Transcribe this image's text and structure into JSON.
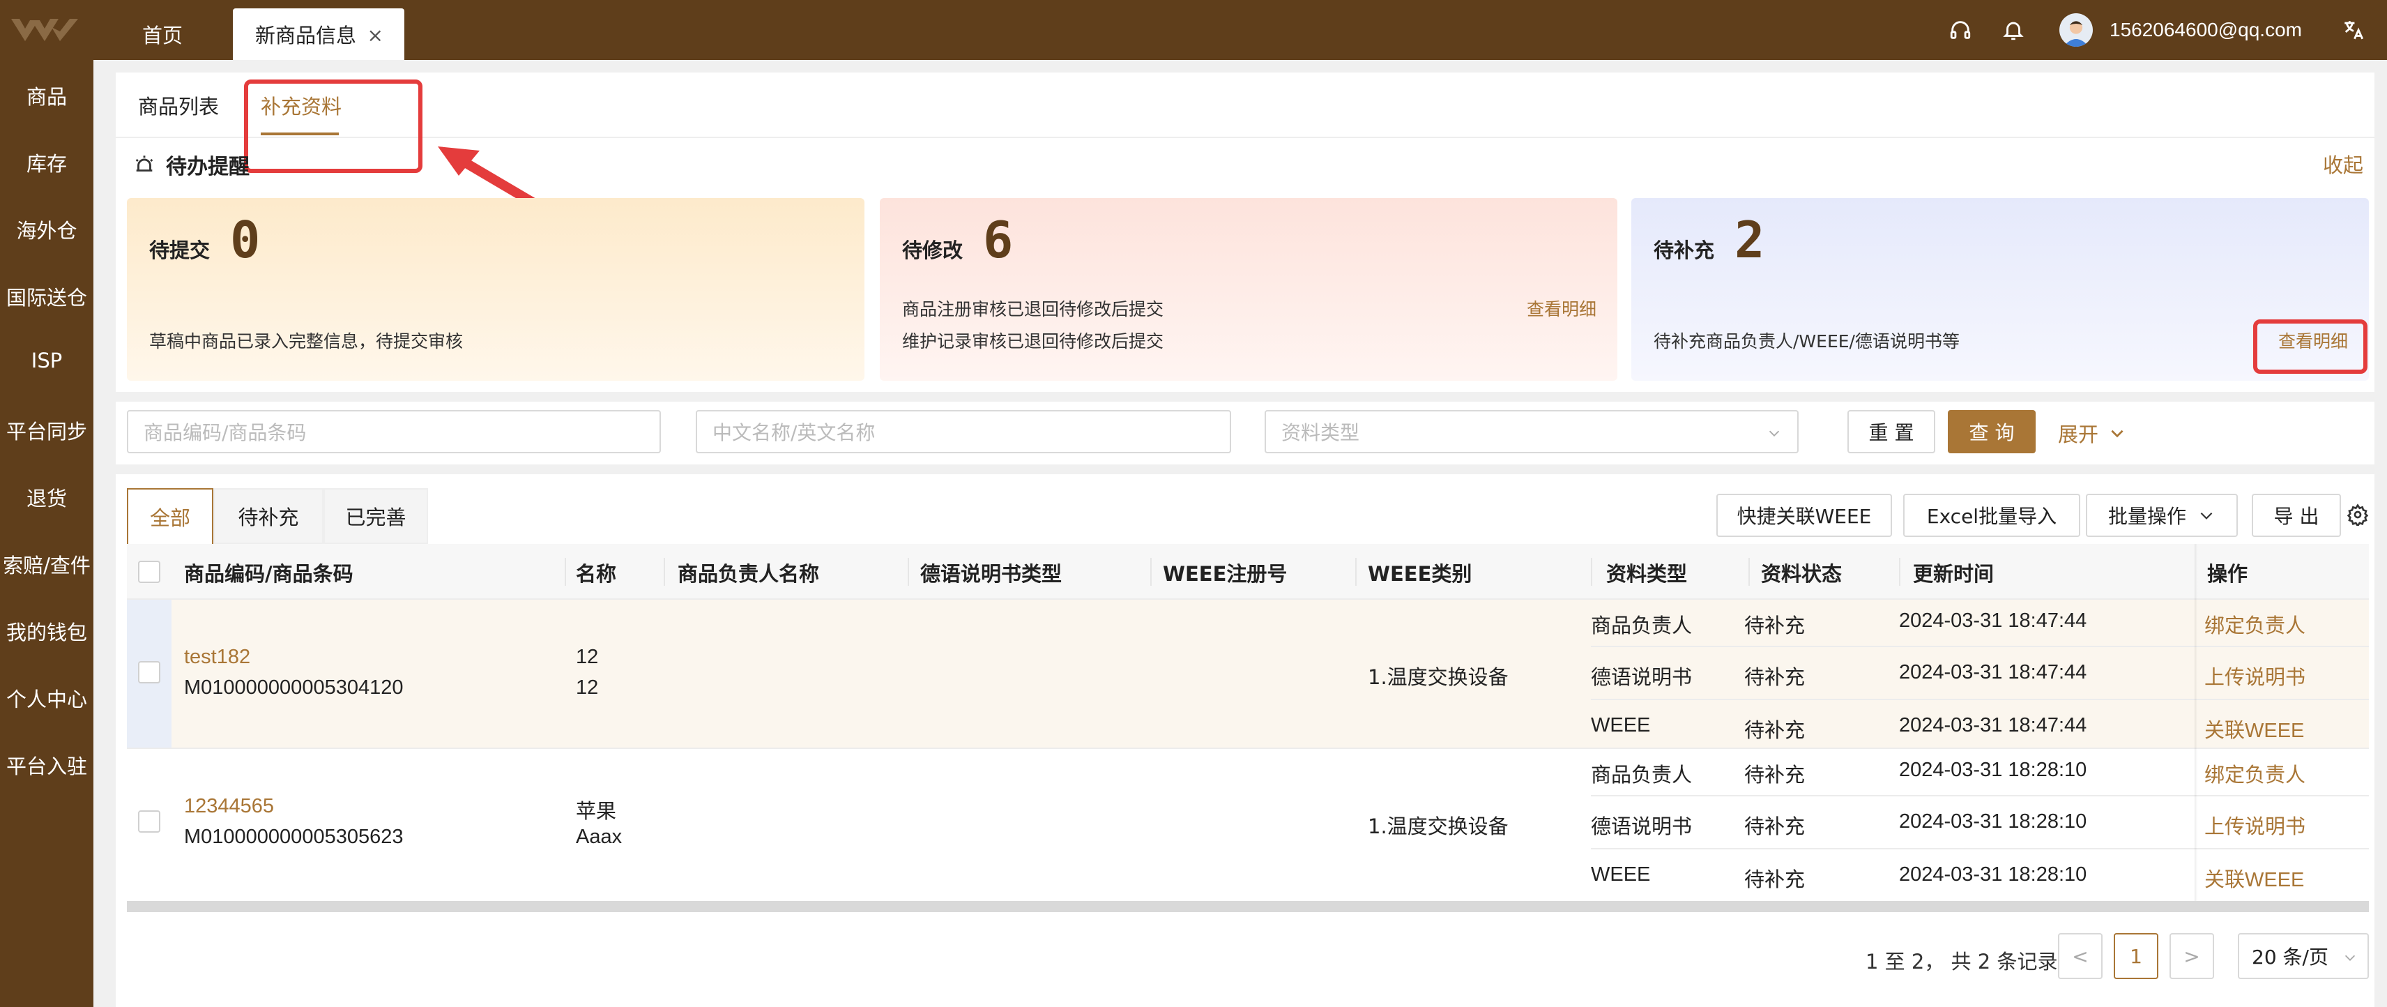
{
  "topbar": {
    "tabs": [
      {
        "label": "首页"
      },
      {
        "label": "新商品信息",
        "close": "×"
      }
    ],
    "user_email": "1562064600@qq.com"
  },
  "sidebar": {
    "items": [
      {
        "label": "商品"
      },
      {
        "label": "库存"
      },
      {
        "label": "海外仓"
      },
      {
        "label": "国际送仓"
      },
      {
        "label": "ISP"
      },
      {
        "label": "平台同步"
      },
      {
        "label": "退货"
      },
      {
        "label": "索赔/查件"
      },
      {
        "label": "我的钱包"
      },
      {
        "label": "个人中心"
      },
      {
        "label": "平台入驻"
      }
    ]
  },
  "subtabs": [
    {
      "label": "商品列表"
    },
    {
      "label": "补充资料"
    }
  ],
  "todo": {
    "title": "待办提醒",
    "collapse": "收起",
    "cards": [
      {
        "label": "待提交",
        "count": "0",
        "desc": [
          "草稿中商品已录入完整信息，待提交审核"
        ],
        "link": ""
      },
      {
        "label": "待修改",
        "count": "6",
        "desc": [
          "商品注册审核已退回待修改后提交",
          "维护记录审核已退回待修改后提交"
        ],
        "link": "查看明细"
      },
      {
        "label": "待补充",
        "count": "2",
        "desc": [
          "待补充商品负责人/WEEE/德语说明书等"
        ],
        "link": "查看明细"
      }
    ]
  },
  "filters": {
    "code_placeholder": "商品编码/商品条码",
    "name_placeholder": "中文名称/英文名称",
    "type_placeholder": "资料类型",
    "reset": "重 置",
    "query": "查 询",
    "expand": "展开"
  },
  "filter_tabs": [
    {
      "label": "全部"
    },
    {
      "label": "待补充"
    },
    {
      "label": "已完善"
    }
  ],
  "toolbar": {
    "weee": "快捷关联WEEE",
    "excel": "Excel批量导入",
    "batch": "批量操作",
    "export": "导 出"
  },
  "table": {
    "columns": [
      "商品编码/商品条码",
      "名称",
      "商品负责人名称",
      "德语说明书类型",
      "WEEE注册号",
      "WEEE类别",
      "资料类型",
      "资料状态",
      "更新时间",
      "操作"
    ],
    "rows": [
      {
        "code": "test182",
        "barcode": "M010000000005304120",
        "name1": "12",
        "name2": "12",
        "weee_category": "1.温度交换设备",
        "subs": [
          {
            "type": "商品负责人",
            "status": "待补充",
            "time": "2024-03-31 18:47:44",
            "op": "绑定负责人"
          },
          {
            "type": "德语说明书",
            "status": "待补充",
            "time": "2024-03-31 18:47:44",
            "op": "上传说明书"
          },
          {
            "type": "WEEE",
            "status": "待补充",
            "time": "2024-03-31 18:47:44",
            "op": "关联WEEE"
          }
        ]
      },
      {
        "code": "12344565",
        "barcode": "M010000000005305623",
        "name1": "苹果",
        "name2": "Aaax",
        "weee_category": "1.温度交换设备",
        "subs": [
          {
            "type": "商品负责人",
            "status": "待补充",
            "time": "2024-03-31 18:28:10",
            "op": "绑定负责人"
          },
          {
            "type": "德语说明书",
            "status": "待补充",
            "time": "2024-03-31 18:28:10",
            "op": "上传说明书"
          },
          {
            "type": "WEEE",
            "status": "待补充",
            "time": "2024-03-31 18:28:10",
            "op": "关联WEEE"
          }
        ]
      }
    ]
  },
  "pagination": {
    "summary": "1 至 2， 共 2 条记录",
    "prev": "<",
    "current": "1",
    "next": ">",
    "page_size": "20 条/页"
  },
  "colors": {
    "brand": "#5f3e1b",
    "accent": "#a97636",
    "highlight": "#e43c3c"
  }
}
